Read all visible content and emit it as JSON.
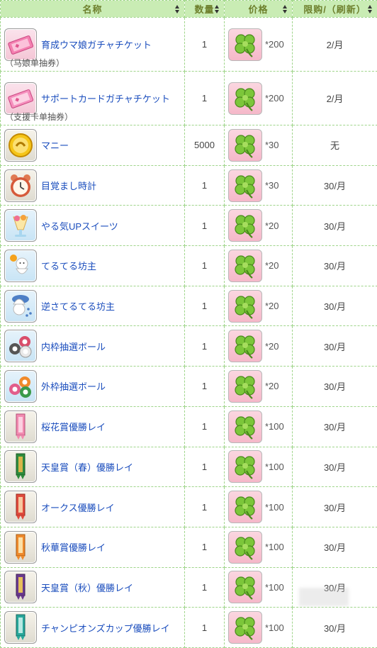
{
  "header": {
    "col_name": "名称",
    "col_qty": "数量",
    "col_price": "价格",
    "col_limit": "限购/（刷新）"
  },
  "rows": [
    {
      "name": "育成ウマ娘ガチャチケット",
      "sub": "（马娘单抽券）",
      "icon": "gacha-ticket-icon",
      "qty": "1",
      "price": "*200",
      "limit": "2/月"
    },
    {
      "name": "サポートカードガチャチケット",
      "sub": "（支援卡单抽券）",
      "icon": "support-ticket-icon",
      "qty": "1",
      "price": "*200",
      "limit": "2/月"
    },
    {
      "name": "マニー",
      "icon": "money-coin-icon",
      "qty": "5000",
      "price": "*30",
      "limit": "无"
    },
    {
      "name": "目覚まし時計",
      "icon": "alarm-clock-icon",
      "qty": "1",
      "price": "*30",
      "limit": "30/月"
    },
    {
      "name": "やる気UPスイーツ",
      "icon": "parfait-icon",
      "qty": "1",
      "price": "*20",
      "limit": "30/月"
    },
    {
      "name": "てるてる坊主",
      "icon": "sunny-doll-icon",
      "qty": "1",
      "price": "*20",
      "limit": "30/月"
    },
    {
      "name": "逆さてるてる坊主",
      "icon": "rainy-doll-icon",
      "qty": "1",
      "price": "*20",
      "limit": "30/月"
    },
    {
      "name": "内枠抽選ボール",
      "icon": "inner-lottery-balls-icon",
      "qty": "1",
      "price": "*20",
      "limit": "30/月"
    },
    {
      "name": "外枠抽選ボール",
      "icon": "outer-lottery-balls-icon",
      "qty": "1",
      "price": "*20",
      "limit": "30/月"
    },
    {
      "name": "桜花賞優勝レイ",
      "icon": "pink-sash-icon",
      "qty": "1",
      "price": "*100",
      "limit": "30/月"
    },
    {
      "name": "天皇賞（春）優勝レイ",
      "icon": "green-sash-icon",
      "qty": "1",
      "price": "*100",
      "limit": "30/月"
    },
    {
      "name": "オークス優勝レイ",
      "icon": "red-sash-icon",
      "qty": "1",
      "price": "*100",
      "limit": "30/月"
    },
    {
      "name": "秋華賞優勝レイ",
      "icon": "orange-sash-icon",
      "qty": "1",
      "price": "*100",
      "limit": "30/月"
    },
    {
      "name": "天皇賞（秋）優勝レイ",
      "icon": "purple-sash-icon",
      "qty": "1",
      "price": "*100",
      "limit": "30/月"
    },
    {
      "name": "チャンピオンズカップ優勝レイ",
      "icon": "teal-sash-icon",
      "qty": "1",
      "price": "*100",
      "limit": "30/月"
    }
  ],
  "price_icon": "clover-icon",
  "colors": {
    "header_bg": "#c9ecb4",
    "border": "#9fd58a",
    "name_link": "#1a4dbd",
    "clover_bg": "#f5b8c9"
  }
}
